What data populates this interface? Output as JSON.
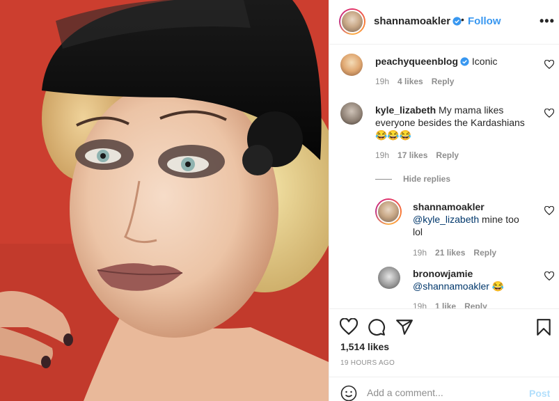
{
  "post": {
    "author": "shannamoakler",
    "follow_label": "Follow",
    "dot": "•",
    "more_label": "•••"
  },
  "comments": [
    {
      "username": "peachyqueenblog",
      "verified": true,
      "text": "Iconic",
      "time": "19h",
      "likes": "4 likes",
      "reply": "Reply"
    },
    {
      "username": "kyle_lizabeth",
      "verified": false,
      "text": "My mama likes everyone besides the Kardashians",
      "emoji": "😂😂😂",
      "time": "19h",
      "likes": "17 likes",
      "reply": "Reply"
    }
  ],
  "hide_replies": "Hide replies",
  "replies": [
    {
      "username": "shannamoakler",
      "mention": "@kyle_lizabeth",
      "text": " mine too lol",
      "time": "19h",
      "likes": "21 likes",
      "reply": "Reply"
    },
    {
      "username": "bronowjamie",
      "mention": "@shannamoakler",
      "emoji": "😂",
      "time": "19h",
      "likes": "1 like",
      "reply": "Reply"
    }
  ],
  "likes_count": "1,514 likes",
  "posted_time": "19 HOURS AGO",
  "add_comment": {
    "placeholder": "Add a comment...",
    "post_label": "Post"
  },
  "colors": {
    "link_blue": "#3897f0",
    "verified_blue": "#3897f0",
    "meta_gray": "#8e8e8e",
    "post_disabled": "#b2dffc",
    "photo_background": "#c93b2c"
  },
  "icons": [
    "verified-badge-icon",
    "more-options-icon",
    "heart-icon",
    "comment-icon",
    "share-icon",
    "bookmark-icon",
    "emoji-icon"
  ]
}
